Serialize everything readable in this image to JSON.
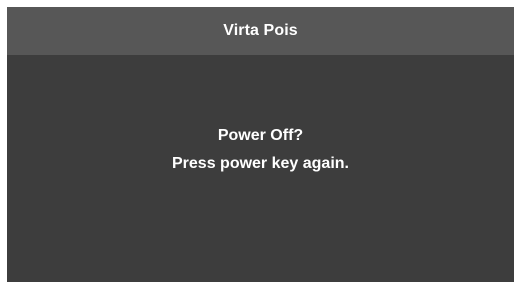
{
  "dialog": {
    "title": "Virta Pois",
    "message_line_1": "Power Off?",
    "message_line_2": "Press power key again."
  },
  "colors": {
    "page_background": "#ffffff",
    "title_bar": "#575757",
    "dialog_body": "#3d3d3d",
    "text": "#ffffff"
  }
}
